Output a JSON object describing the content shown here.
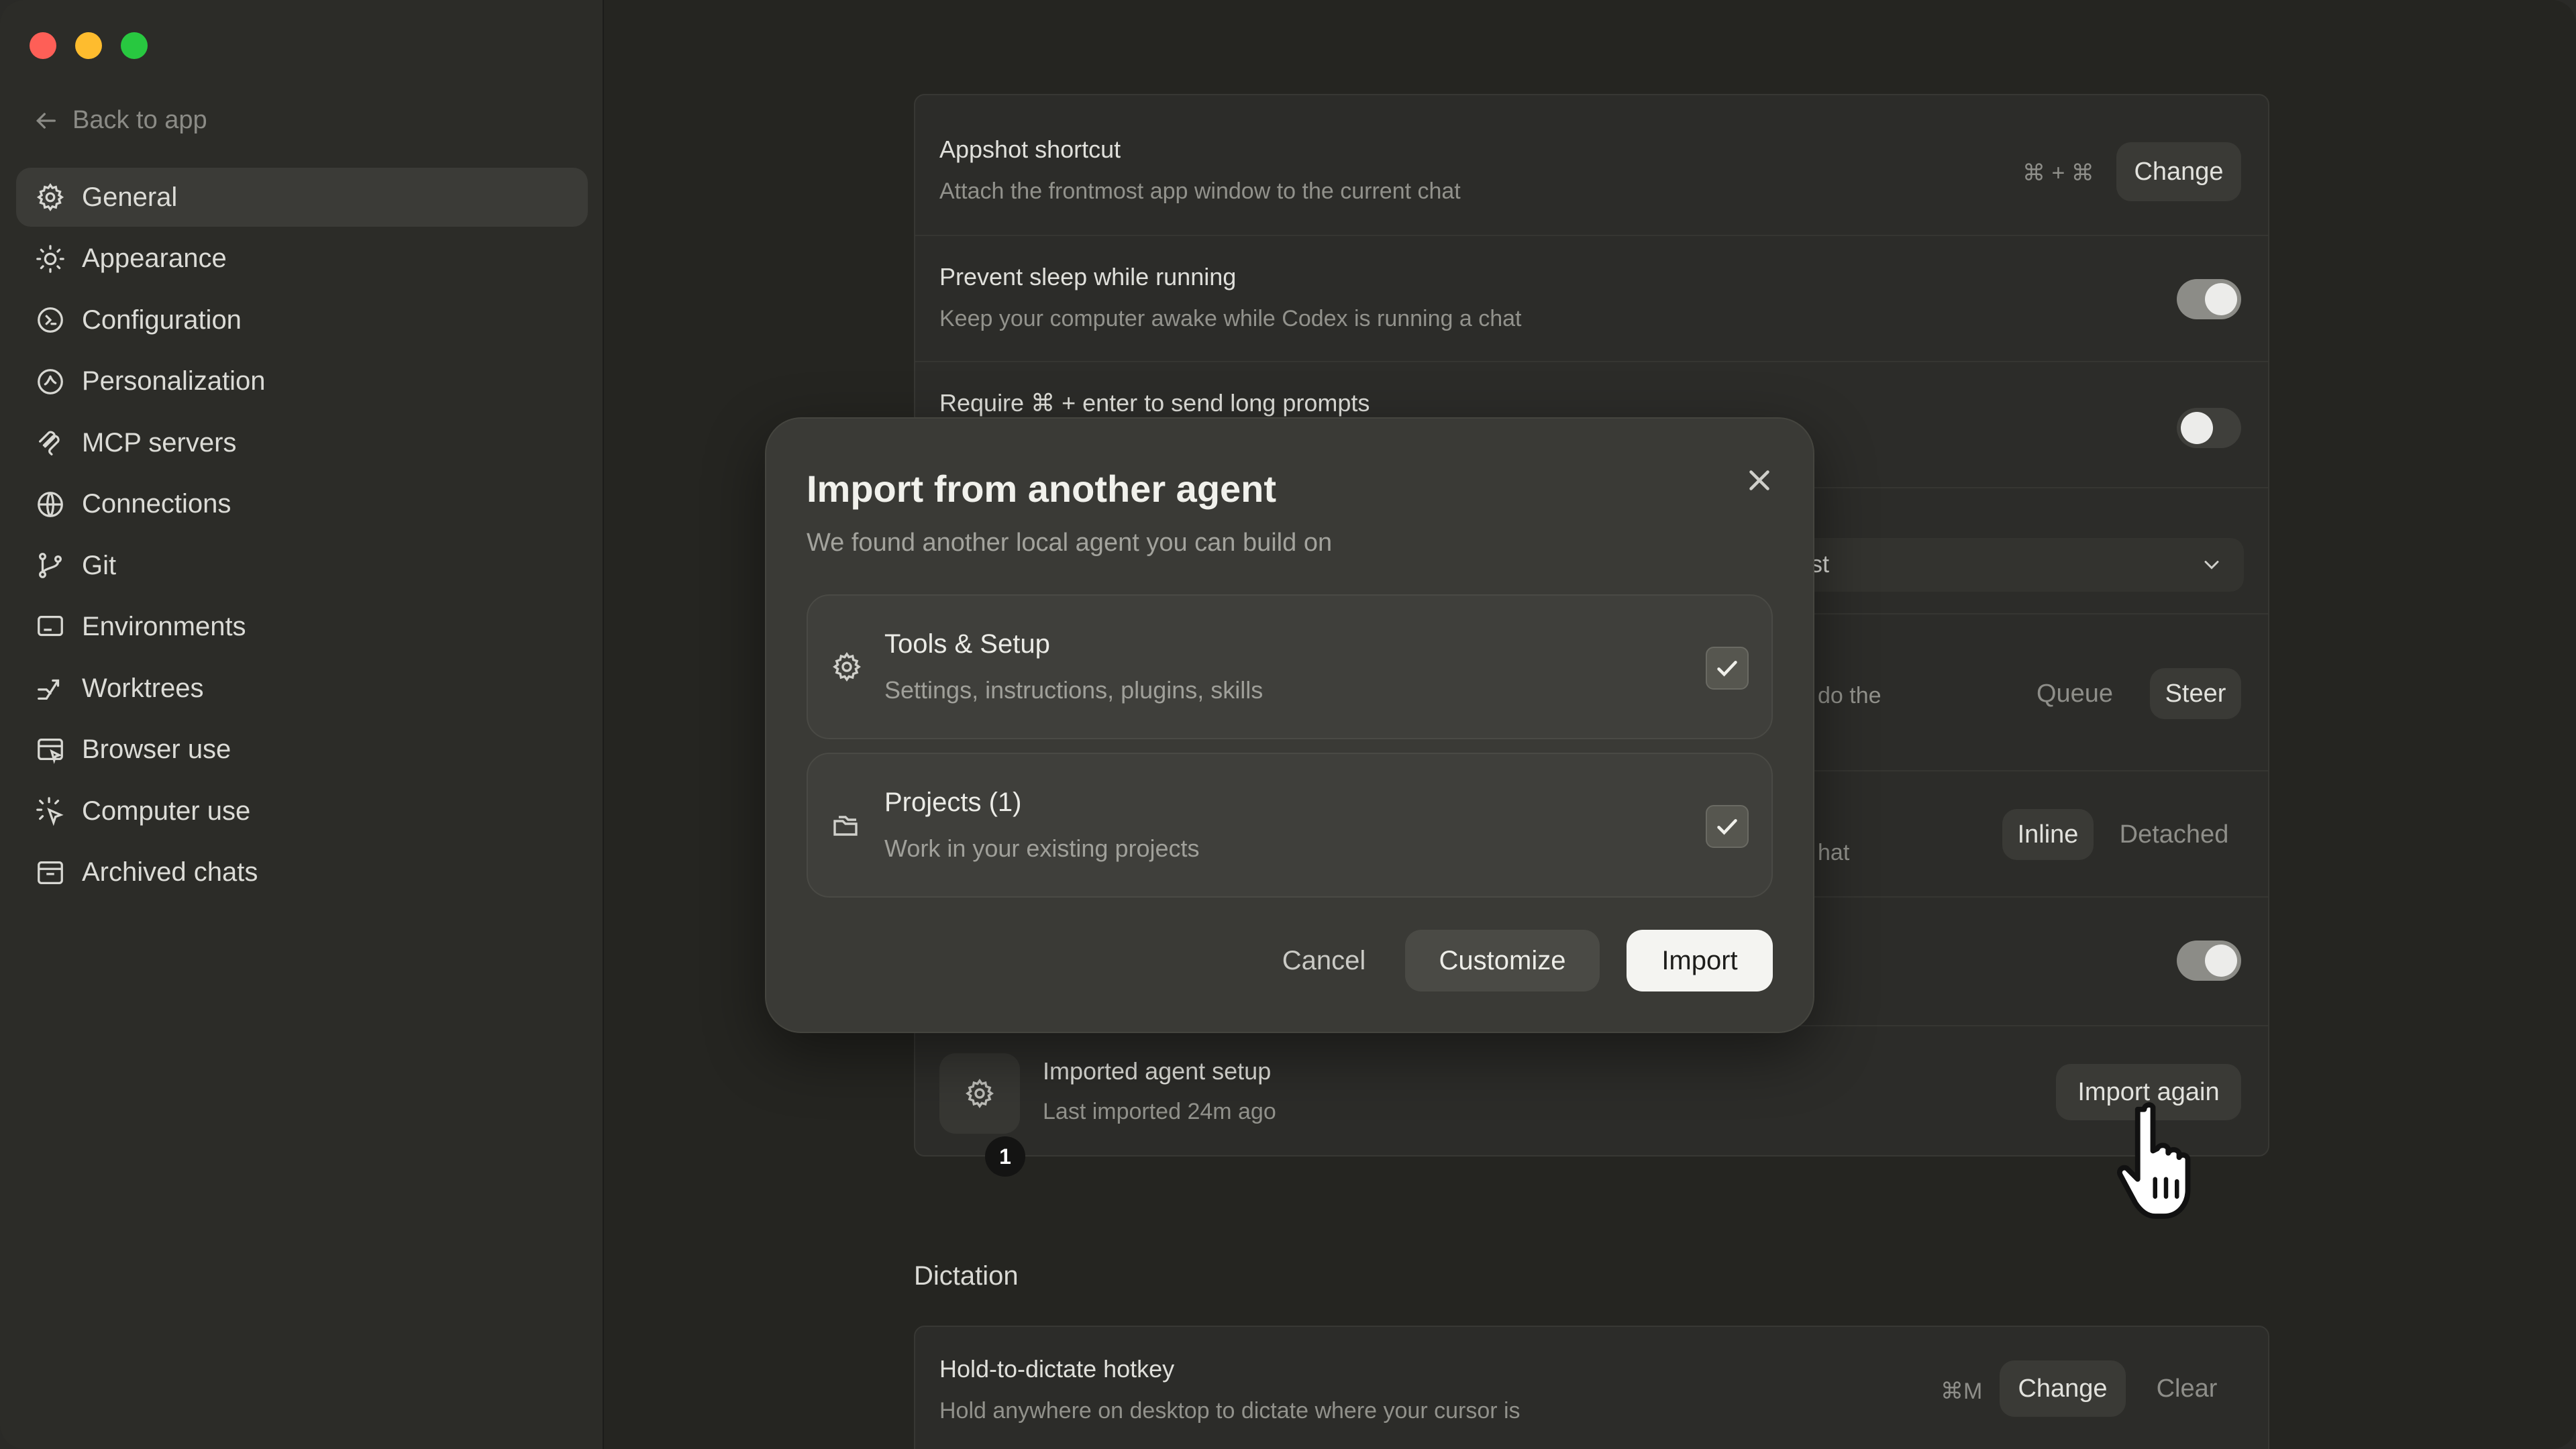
{
  "window": {
    "traffic_colors": [
      "#fe5f57",
      "#febc2e",
      "#28c840"
    ]
  },
  "sidebar": {
    "back_label": "Back to app",
    "items": [
      {
        "label": "General",
        "icon": "gear-icon",
        "active": true
      },
      {
        "label": "Appearance",
        "icon": "sun-icon"
      },
      {
        "label": "Configuration",
        "icon": "config-icon"
      },
      {
        "label": "Personalization",
        "icon": "personalization-icon"
      },
      {
        "label": "MCP servers",
        "icon": "mcp-icon"
      },
      {
        "label": "Connections",
        "icon": "globe-icon"
      },
      {
        "label": "Git",
        "icon": "git-branch-icon"
      },
      {
        "label": "Environments",
        "icon": "monitor-icon"
      },
      {
        "label": "Worktrees",
        "icon": "worktree-icon"
      },
      {
        "label": "Browser use",
        "icon": "browser-icon"
      },
      {
        "label": "Computer use",
        "icon": "pointer-icon"
      },
      {
        "label": "Archived chats",
        "icon": "archive-icon"
      }
    ]
  },
  "settings": {
    "appshot": {
      "title": "Appshot shortcut",
      "desc": "Attach the frontmost app window to the current chat",
      "shortcut": "⌘ + ⌘",
      "button": "Change"
    },
    "prevent_sleep": {
      "title": "Prevent sleep while running",
      "desc": "Keep your computer awake while Codex is running a chat",
      "enabled": true
    },
    "require_enter": {
      "title": "Require ⌘ + enter to send long prompts",
      "enabled": false
    },
    "select_fragment": "st",
    "queue_row": {
      "desc_fragment": "do the",
      "options": [
        "Queue",
        "Steer"
      ],
      "selected": "Steer"
    },
    "inline_row": {
      "desc_fragment": "hat",
      "options": [
        "Inline",
        "Detached"
      ],
      "selected": "Inline"
    },
    "toggle_row": {
      "enabled": true
    },
    "imported": {
      "title": "Imported agent setup",
      "desc": "Last imported 24m ago",
      "button": "Import again",
      "badge": "1"
    }
  },
  "dictation": {
    "section_title": "Dictation",
    "hotkey": {
      "title": "Hold-to-dictate hotkey",
      "desc": "Hold anywhere on desktop to dictate where your cursor is",
      "shortcut": "⌘M",
      "change": "Change",
      "clear": "Clear"
    }
  },
  "modal": {
    "title": "Import from another agent",
    "subtitle": "We found another local agent you can build on",
    "options": [
      {
        "title": "Tools & Setup",
        "desc": "Settings, instructions, plugins, skills",
        "icon": "gear-icon",
        "checked": true
      },
      {
        "title": "Projects (1)",
        "desc": "Work in your existing projects",
        "icon": "folders-icon",
        "checked": true
      }
    ],
    "cancel": "Cancel",
    "customize": "Customize",
    "import": "Import"
  }
}
